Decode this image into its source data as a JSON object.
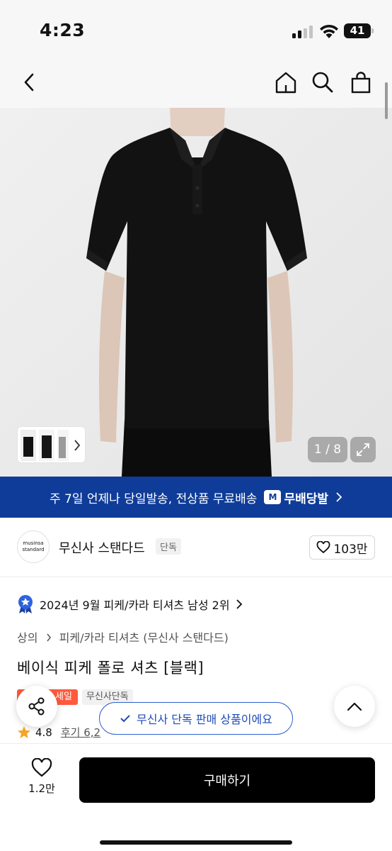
{
  "status_bar": {
    "time": "4:23",
    "battery": "41"
  },
  "nav": {
    "back_icon": "chevron-left-icon",
    "home_icon": "home-icon",
    "search_icon": "search-icon",
    "cart_icon": "shopping-bag-icon"
  },
  "gallery": {
    "counter": "1 / 8",
    "thumb_count": 3
  },
  "banner": {
    "text": "주 7일 언제나 당일발송, 전상품 무료배송",
    "logo_badge": "M",
    "logo_text": "무배당발"
  },
  "brand": {
    "logo_line1": "musinsa",
    "logo_line2": "standard",
    "name": "무신사 스탠다드",
    "tag": "단독",
    "likes": "103만"
  },
  "ranking": {
    "text": "2024년 9월 피케/카라 티셔츠 남성 2위"
  },
  "breadcrumb": {
    "level1": "상의",
    "level2": "피케/카라 티셔츠 (무신사 스탠다드)"
  },
  "product": {
    "title": "베이식 피케 폴로 셔츠 [블랙]",
    "tag_sale": "세일",
    "tag_exclusive": "무신사단독",
    "rating": "4.8",
    "review": "후기 6,2"
  },
  "toast": {
    "text": "무신사 단독 판매 상품이에요"
  },
  "bottom": {
    "wish_count": "1.2만",
    "buy_label": "구매하기"
  },
  "colors": {
    "banner": "#0f3c99",
    "sale": "#ff5a3c",
    "toast_border": "#2e5fd0",
    "buy": "#000000"
  }
}
